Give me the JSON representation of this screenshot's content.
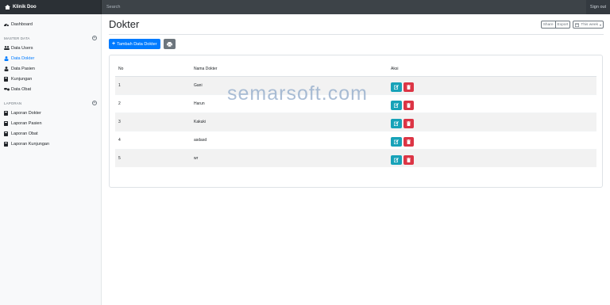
{
  "navbar": {
    "brand": "Klinik Doo",
    "search_placeholder": "Search",
    "signout": "Sign out"
  },
  "sidebar": {
    "dashboard": "Dashboard",
    "master_heading": "MASTER DATA",
    "master_items": [
      {
        "label": "Data Users",
        "icon": "users-icon"
      },
      {
        "label": "Data Dokter",
        "icon": "doctor-icon",
        "active": true
      },
      {
        "label": "Data Pasien",
        "icon": "user-icon"
      },
      {
        "label": "Kunjungan",
        "icon": "book-icon"
      },
      {
        "label": "Data Obat",
        "icon": "pills-icon"
      }
    ],
    "laporan_heading": "LAPORAN",
    "laporan_items": [
      {
        "label": "Laporan Dokter"
      },
      {
        "label": "Laporan Pasien"
      },
      {
        "label": "Laporan Obat"
      },
      {
        "label": "Laporan Kunjungan"
      }
    ]
  },
  "main": {
    "title": "Dokter",
    "share": "Share",
    "export": "Export",
    "this_week": "This week",
    "add_button": "Tambah Data Dokter"
  },
  "table": {
    "headers": [
      "No",
      "Nama Dokter",
      "Aksi"
    ],
    "rows": [
      {
        "no": "1",
        "nama": "Gani"
      },
      {
        "no": "2",
        "nama": "Harun"
      },
      {
        "no": "3",
        "nama": "Kakuki"
      },
      {
        "no": "4",
        "nama": "asdasd"
      },
      {
        "no": "5",
        "nama": "wr"
      }
    ]
  },
  "watermark": "semarsoft.com",
  "colors": {
    "navbar": "#343a40",
    "primary": "#007bff",
    "info": "#17a2b8",
    "danger": "#dc3545",
    "secondary": "#6c757d"
  }
}
